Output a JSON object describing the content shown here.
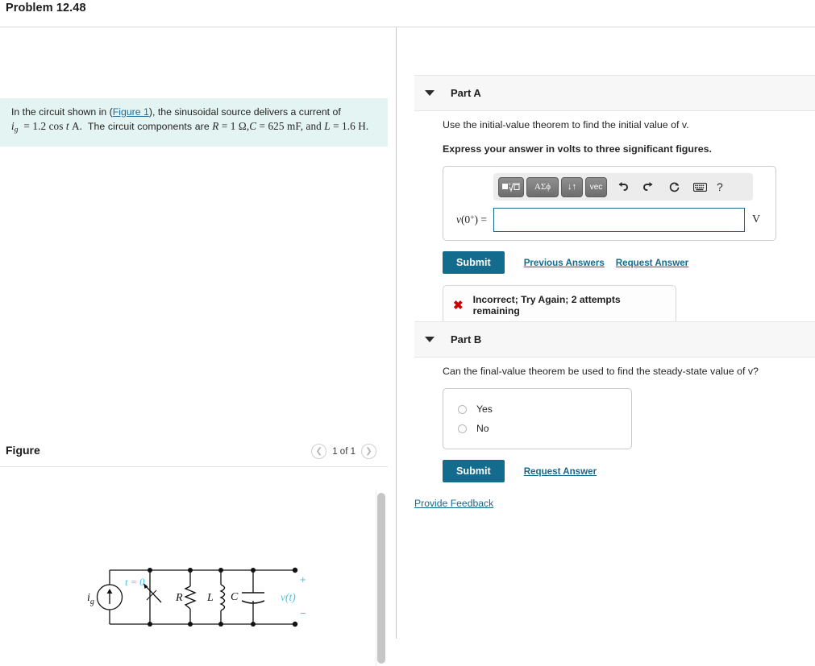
{
  "header": {
    "problem_title": "Problem 12.48"
  },
  "problem": {
    "line1_pre": "In the circuit shown in (",
    "figure_link": "Figure 1",
    "line1_post": "), the sinusoidal source delivers a current of",
    "current_expr": "i_g = 1.2 cos t A.",
    "components_text": "The circuit components are R = 1 Ω, C = 625 mF, and L = 1.6 H.",
    "values": {
      "current_amplitude": "1.2",
      "current_label": "i_g",
      "current_unit": "A",
      "R": "1",
      "R_unit": "Ω",
      "C": "625",
      "C_unit": "mF",
      "L": "1.6",
      "L_unit": "H"
    }
  },
  "figure": {
    "title": "Figure",
    "pager_label": "1 of 1",
    "prev_icon": "chevron-left-icon",
    "next_icon": "chevron-right-icon",
    "circuit": {
      "source_label": "i_g",
      "switch_label": "t = 0",
      "resistor_label": "R",
      "inductor_label": "L",
      "capacitor_label": "C",
      "voltage_label": "v(t)",
      "plus_sign": "+",
      "minus_sign": "−",
      "accent_color": "#45c3e8"
    }
  },
  "parts": [
    {
      "id": "part-a",
      "label": "Part A",
      "caret_icon": "caret-down-icon",
      "prompt": "Use the initial-value theorem to find the initial value of v.",
      "prompt_math_var": "v",
      "instruction": "Express your answer in volts to three significant figures.",
      "answer": {
        "variable_label": "v(0⁺) =",
        "value": "",
        "placeholder": "",
        "unit": "V"
      },
      "toolbar": {
        "buttons": [
          {
            "name": "math-template-button",
            "glyph": "■ⁿ√□"
          },
          {
            "name": "greek-letters-button",
            "glyph": "ΑΣϕ"
          },
          {
            "name": "sub-superscript-button",
            "glyph": "↓↑"
          },
          {
            "name": "vector-button",
            "glyph": "vec"
          }
        ],
        "icons": [
          {
            "name": "undo-icon",
            "glyph": "↩"
          },
          {
            "name": "redo-icon",
            "glyph": "↪"
          },
          {
            "name": "reset-icon",
            "glyph": "↻"
          },
          {
            "name": "keyboard-icon",
            "glyph": "⌨"
          }
        ],
        "help": "?"
      },
      "buttons": {
        "submit": "Submit",
        "previous_answers": "Previous Answers",
        "request_answer": "Request Answer"
      },
      "alert": {
        "icon": "x-mark-icon",
        "symbol": "✖",
        "text": "Incorrect; Try Again; 2 attempts remaining",
        "color": "#cc0000"
      }
    },
    {
      "id": "part-b",
      "label": "Part B",
      "caret_icon": "caret-down-icon",
      "prompt": "Can the final-value theorem be used to find the steady-state value of v?",
      "options": [
        {
          "label": "Yes",
          "selected": false
        },
        {
          "label": "No",
          "selected": false
        }
      ],
      "buttons": {
        "submit": "Submit",
        "request_answer": "Request Answer"
      }
    }
  ],
  "footer": {
    "provide_feedback": "Provide Feedback"
  },
  "colors": {
    "accent": "#136c8d",
    "statement_bg": "#e4f4f2",
    "part_header_bg": "#f7f7f7",
    "error": "#cc0000",
    "circuit_accent": "#45c3e8"
  }
}
